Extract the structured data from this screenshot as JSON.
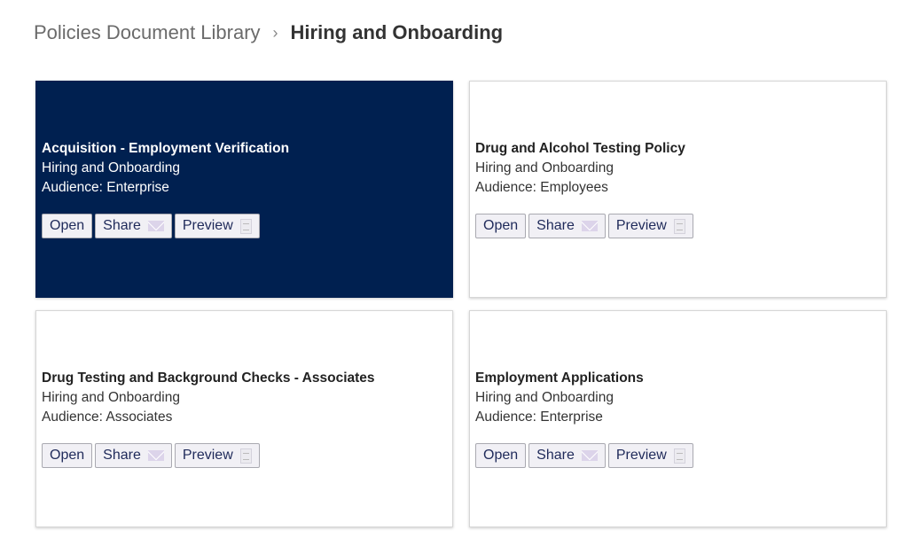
{
  "breadcrumb": {
    "parent": "Policies Document Library",
    "separator": "›",
    "current": "Hiring and Onboarding"
  },
  "cards": [
    {
      "title": "Acquisition - Employment Verification",
      "category": "Hiring and Onboarding",
      "audience": "Audience: Enterprise",
      "selected": true
    },
    {
      "title": "Drug and Alcohol Testing Policy",
      "category": "Hiring and Onboarding",
      "audience": "Audience: Employees",
      "selected": false
    },
    {
      "title": "Drug Testing and Background Checks - Associates",
      "category": "Hiring and Onboarding",
      "audience": "Audience: Associates",
      "selected": false
    },
    {
      "title": "Employment Applications",
      "category": "Hiring and Onboarding",
      "audience": "Audience: Enterprise",
      "selected": false
    }
  ],
  "buttons": {
    "open": "Open",
    "share": "Share",
    "preview": "Preview"
  },
  "colors": {
    "selected_card": "#002050",
    "button_text": "#1f2a5a"
  }
}
